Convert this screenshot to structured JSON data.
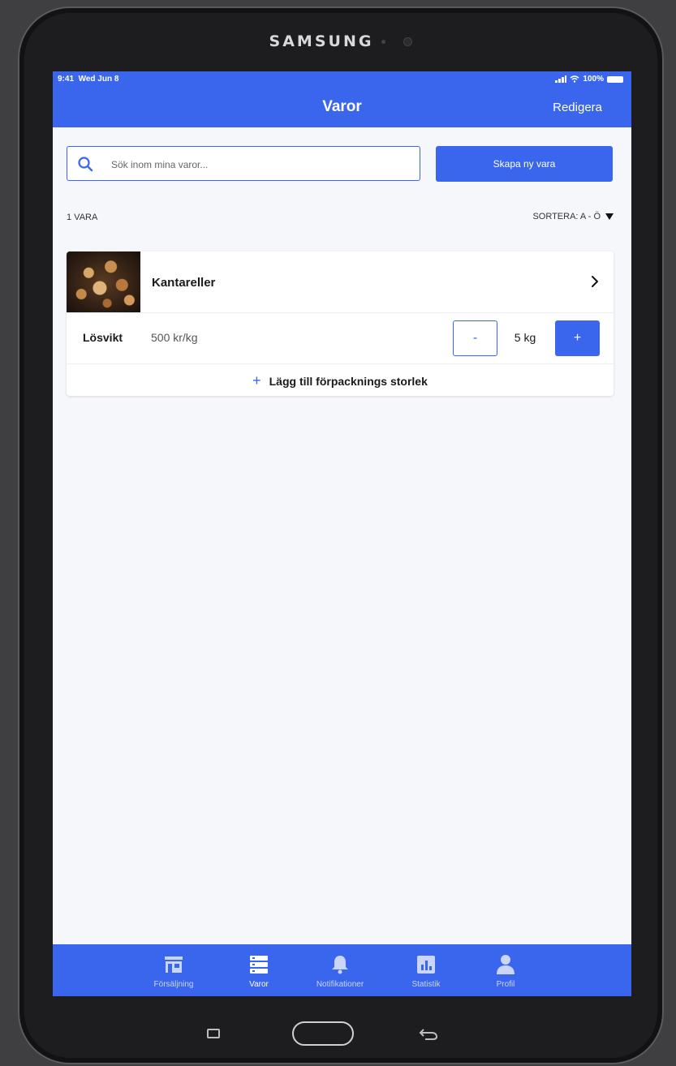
{
  "device": {
    "brand": "SAMSUNG"
  },
  "statusbar": {
    "time": "9:41",
    "date": "Wed Jun 8",
    "battery": "100%"
  },
  "navbar": {
    "title": "Varor",
    "edit_label": "Redigera"
  },
  "search": {
    "placeholder": "Sök inom mina varor...",
    "icon": "search-icon"
  },
  "actions": {
    "create_label": "Skapa ny vara"
  },
  "list": {
    "count_label": "1 VARA",
    "sort_label": "SORTERA: A - Ö"
  },
  "product": {
    "name": "Kantareller",
    "unit_type": "Lösvikt",
    "price": "500 kr/kg",
    "minus_label": "-",
    "quantity": "5 kg",
    "plus_label": "+",
    "add_size_label": "Lägg till förpacknings storlek"
  },
  "tabs": [
    {
      "label": "Försäljning",
      "icon": "store-icon",
      "active": false
    },
    {
      "label": "Varor",
      "icon": "list-icon",
      "active": true
    },
    {
      "label": "Notifikationer",
      "icon": "bell-icon",
      "active": false
    },
    {
      "label": "Statistik",
      "icon": "chart-icon",
      "active": false
    },
    {
      "label": "Profil",
      "icon": "person-icon",
      "active": false
    }
  ],
  "colors": {
    "accent": "#3a66ee",
    "background": "#f6f7fb",
    "bezel": "#1d1d1f"
  }
}
